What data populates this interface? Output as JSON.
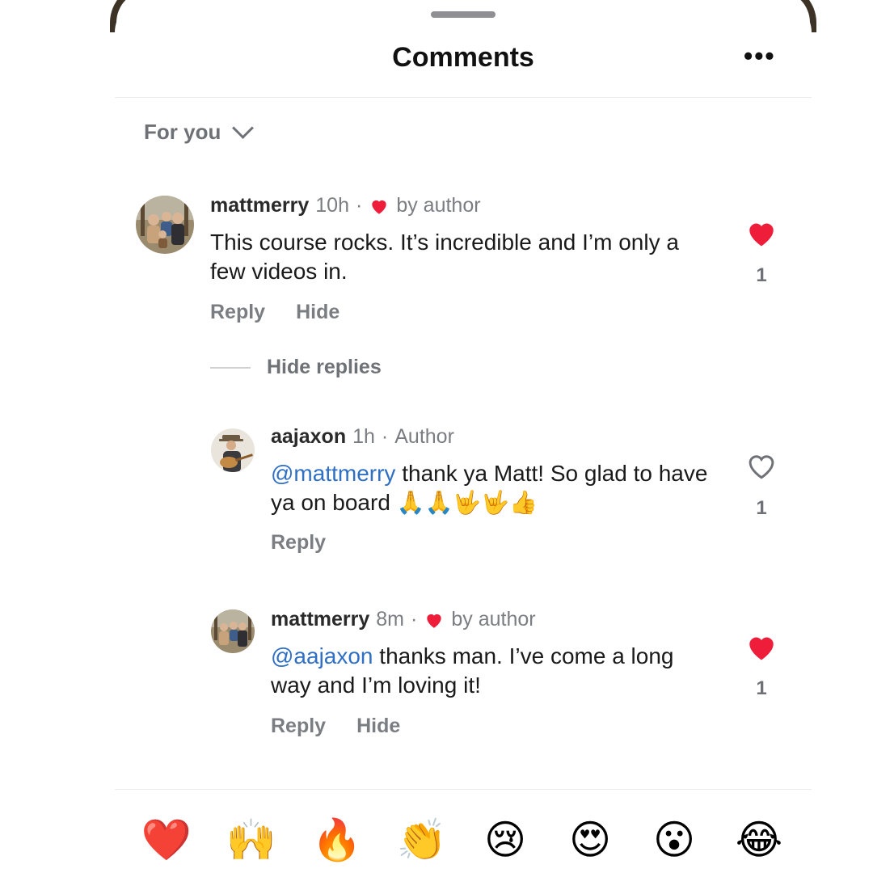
{
  "header": {
    "title": "Comments",
    "more_label": "•••"
  },
  "filter": {
    "label": "For you"
  },
  "comments": [
    {
      "username": "mattmerry",
      "time": "10h",
      "separator": "·",
      "badge": "by author",
      "text": "This course rocks. It’s incredible and I’m only a few videos in.",
      "liked": true,
      "like_count": "1",
      "actions": {
        "reply": "Reply",
        "hide": "Hide"
      }
    }
  ],
  "hide_replies_label": "Hide replies",
  "replies": [
    {
      "username": "aajaxon",
      "time": "1h",
      "separator": "·",
      "badge": "Author",
      "mention": "@mattmerry",
      "text": " thank ya Matt! So glad to have ya on board 🙏🙏🤟🤟👍",
      "liked": false,
      "like_count": "1",
      "actions": {
        "reply": "Reply"
      }
    },
    {
      "username": "mattmerry",
      "time": "8m",
      "separator": "·",
      "badge": "by author",
      "mention": "@aajaxon",
      "text": " thanks man. I’ve come a long way and I’m loving it!",
      "liked": true,
      "like_count": "1",
      "actions": {
        "reply": "Reply",
        "hide": "Hide"
      }
    }
  ],
  "reactions": [
    "❤️",
    "🙌",
    "🔥",
    "👏",
    "😢",
    "😍",
    "😮",
    "😂"
  ],
  "colors": {
    "heart": "#ee1d3a",
    "mention": "#2f6fc4",
    "muted": "#7a7d82"
  }
}
